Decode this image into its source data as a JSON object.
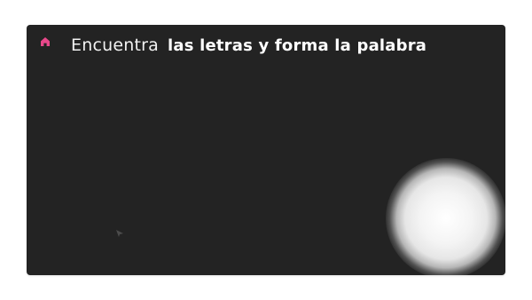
{
  "header": {
    "home_icon": "home-icon",
    "title_regular": "Encuentra",
    "title_bold": "las letras y forma la palabra"
  },
  "colors": {
    "stage_background": "#232323",
    "home_icon": "#e8488a",
    "title_text": "#ffffff"
  }
}
